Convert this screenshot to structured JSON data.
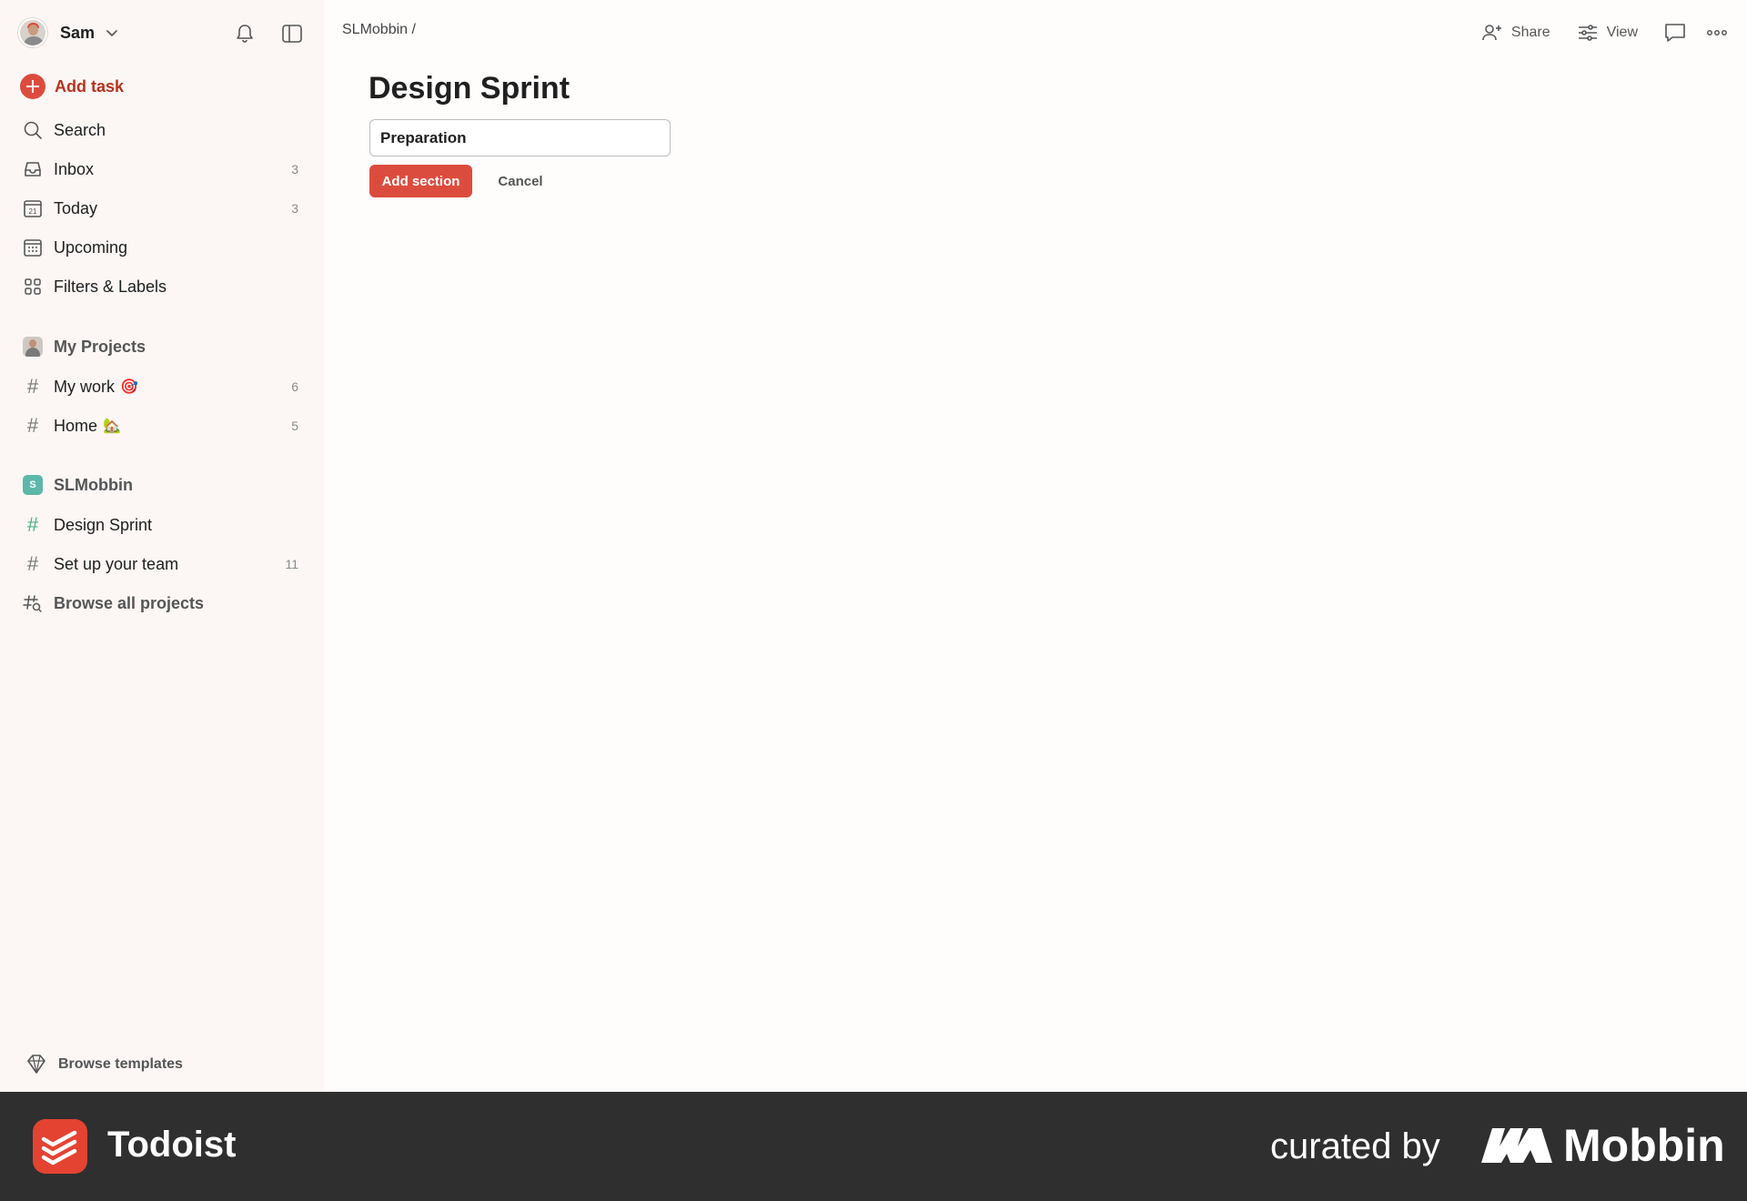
{
  "user": {
    "name": "Sam"
  },
  "sidebar": {
    "add_task": "Add task",
    "nav": [
      {
        "label": "Search",
        "count": ""
      },
      {
        "label": "Inbox",
        "count": "3"
      },
      {
        "label": "Today",
        "count": "3",
        "icon_day": "21"
      },
      {
        "label": "Upcoming",
        "count": ""
      },
      {
        "label": "Filters & Labels",
        "count": ""
      }
    ],
    "my_projects": {
      "title": "My Projects",
      "items": [
        {
          "label": "My work",
          "emoji": "🎯",
          "count": "6"
        },
        {
          "label": "Home",
          "emoji": "🏡",
          "count": "5"
        }
      ]
    },
    "team": {
      "badge": "S",
      "title": "SLMobbin",
      "items": [
        {
          "label": "Design Sprint",
          "count": ""
        },
        {
          "label": "Set up your team",
          "count": "11"
        },
        {
          "label": "Browse all projects",
          "count": ""
        }
      ]
    },
    "browse_templates": "Browse templates"
  },
  "header": {
    "breadcrumb": "SLMobbin /",
    "share": "Share",
    "view": "View"
  },
  "main": {
    "title": "Design Sprint",
    "section_input_value": "Preparation",
    "add_section": "Add section",
    "cancel": "Cancel"
  },
  "footer": {
    "app_name": "Todoist",
    "curated_by": "curated by",
    "brand": "Mobbin"
  },
  "colors": {
    "accent": "#dc4c3e",
    "sidebar_bg": "#fcf7f5",
    "footer_bg": "#2f2f2f",
    "team_badge": "#5cb8a8"
  }
}
